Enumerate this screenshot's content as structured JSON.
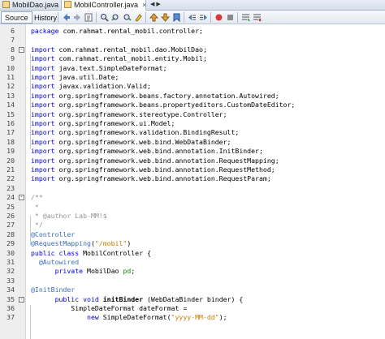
{
  "tabs": [
    {
      "label": "MobilDao.java",
      "close": "×"
    },
    {
      "label": "MobilController.java",
      "close": "×"
    }
  ],
  "tab_scroll": [
    "◀",
    "▶"
  ],
  "views": {
    "source": "Source",
    "history": "History"
  },
  "toolbar_icons": [
    "back-icon",
    "forward-icon",
    "last-edit-icon",
    "find-icon",
    "find-prev-icon",
    "find-next-icon",
    "toggle-highlight-icon",
    "bookmark-prev-icon",
    "bookmark-next-icon",
    "toggle-bookmark-icon",
    "shift-left-icon",
    "shift-right-icon",
    "start-macro-icon",
    "stop-macro-icon",
    "comment-icon",
    "uncomment-icon"
  ],
  "colors": {
    "keyword": "#0000e6",
    "comment": "#969696",
    "annotation": "#3c6ebc",
    "string": "#ce7b00",
    "field": "#009900"
  },
  "lines": [
    {
      "n": "6",
      "parts": [
        {
          "t": "package",
          "c": "k"
        },
        {
          "t": " com.rahmat.rental_mobil.controller;"
        }
      ]
    },
    {
      "n": "7",
      "parts": []
    },
    {
      "n": "8",
      "fold": "-",
      "parts": [
        {
          "t": "import",
          "c": "k"
        },
        {
          "t": " com.rahmat.rental_mobil.dao.MobilDao;"
        }
      ]
    },
    {
      "n": "9",
      "parts": [
        {
          "t": "import",
          "c": "k"
        },
        {
          "t": " com.rahmat.rental_mobil.entity.Mobil;"
        }
      ]
    },
    {
      "n": "10",
      "parts": [
        {
          "t": "import",
          "c": "k"
        },
        {
          "t": " java.text.SimpleDateFormat;"
        }
      ]
    },
    {
      "n": "11",
      "parts": [
        {
          "t": "import",
          "c": "k"
        },
        {
          "t": " java.util.Date;"
        }
      ]
    },
    {
      "n": "12",
      "parts": [
        {
          "t": "import",
          "c": "k"
        },
        {
          "t": " javax.validation.Valid;"
        }
      ]
    },
    {
      "n": "13",
      "parts": [
        {
          "t": "import",
          "c": "k"
        },
        {
          "t": " org.springframework.beans.factory.annotation.Autowired;"
        }
      ]
    },
    {
      "n": "14",
      "parts": [
        {
          "t": "import",
          "c": "k"
        },
        {
          "t": " org.springframework.beans.propertyeditors.CustomDateEditor;"
        }
      ]
    },
    {
      "n": "15",
      "parts": [
        {
          "t": "import",
          "c": "k"
        },
        {
          "t": " org.springframework.stereotype.Controller;"
        }
      ]
    },
    {
      "n": "16",
      "parts": [
        {
          "t": "import",
          "c": "k"
        },
        {
          "t": " org.springframework.ui.Model;"
        }
      ]
    },
    {
      "n": "17",
      "parts": [
        {
          "t": "import",
          "c": "k"
        },
        {
          "t": " org.springframework.validation.BindingResult;"
        }
      ]
    },
    {
      "n": "18",
      "parts": [
        {
          "t": "import",
          "c": "k"
        },
        {
          "t": " org.springframework.web.bind.WebDataBinder;"
        }
      ]
    },
    {
      "n": "19",
      "parts": [
        {
          "t": "import",
          "c": "k"
        },
        {
          "t": " org.springframework.web.bind.annotation.InitBinder;"
        }
      ]
    },
    {
      "n": "20",
      "parts": [
        {
          "t": "import",
          "c": "k"
        },
        {
          "t": " org.springframework.web.bind.annotation.RequestMapping;"
        }
      ]
    },
    {
      "n": "21",
      "parts": [
        {
          "t": "import",
          "c": "k"
        },
        {
          "t": " org.springframework.web.bind.annotation.RequestMethod;"
        }
      ]
    },
    {
      "n": "22",
      "parts": [
        {
          "t": "import",
          "c": "k"
        },
        {
          "t": " org.springframework.web.bind.annotation.RequestParam;"
        }
      ]
    },
    {
      "n": "23",
      "parts": []
    },
    {
      "n": "24",
      "fold": "-",
      "parts": [
        {
          "t": "/**",
          "c": "c"
        }
      ]
    },
    {
      "n": "25",
      "parts": [
        {
          "t": " *",
          "c": "c"
        }
      ]
    },
    {
      "n": "26",
      "parts": [
        {
          "t": " * @author Lab-MM!$",
          "c": "c"
        }
      ]
    },
    {
      "n": "27",
      "parts": [
        {
          "t": " */",
          "c": "c"
        }
      ]
    },
    {
      "n": "28",
      "parts": [
        {
          "t": "@Controller",
          "c": "a"
        }
      ]
    },
    {
      "n": "29",
      "parts": [
        {
          "t": "@RequestMapping",
          "c": "a"
        },
        {
          "t": "("
        },
        {
          "t": "\"/mobil\"",
          "c": "s"
        },
        {
          "t": ")"
        }
      ]
    },
    {
      "n": "30",
      "parts": [
        {
          "t": "public",
          "c": "k"
        },
        {
          "t": " "
        },
        {
          "t": "class",
          "c": "k"
        },
        {
          "t": " MobilController {"
        }
      ]
    },
    {
      "n": "31",
      "parts": [
        {
          "t": "  "
        },
        {
          "t": "@Autowired",
          "c": "a"
        }
      ]
    },
    {
      "n": "32",
      "parts": [
        {
          "t": "      "
        },
        {
          "t": "private",
          "c": "k"
        },
        {
          "t": " MobilDao "
        },
        {
          "t": "pd",
          "c": "o"
        },
        {
          "t": ";"
        }
      ]
    },
    {
      "n": "33",
      "parts": []
    },
    {
      "n": "34",
      "parts": [
        {
          "t": "@InitBinder",
          "c": "a"
        }
      ]
    },
    {
      "n": "35",
      "fold": "-",
      "parts": [
        {
          "t": "      "
        },
        {
          "t": "public",
          "c": "k"
        },
        {
          "t": " "
        },
        {
          "t": "void",
          "c": "k"
        },
        {
          "t": " "
        },
        {
          "t": "initBinder",
          "c": "m"
        },
        {
          "t": " (WebDataBinder binder) {"
        }
      ]
    },
    {
      "n": "36",
      "parts": [
        {
          "t": "          SimpleDateFormat dateFormat ="
        }
      ]
    },
    {
      "n": "37",
      "parts": [
        {
          "t": "              "
        },
        {
          "t": "new",
          "c": "k"
        },
        {
          "t": " SimpleDateFormat("
        },
        {
          "t": "\"yyyy-MM-dd\"",
          "c": "s"
        },
        {
          "t": ");"
        }
      ]
    }
  ]
}
